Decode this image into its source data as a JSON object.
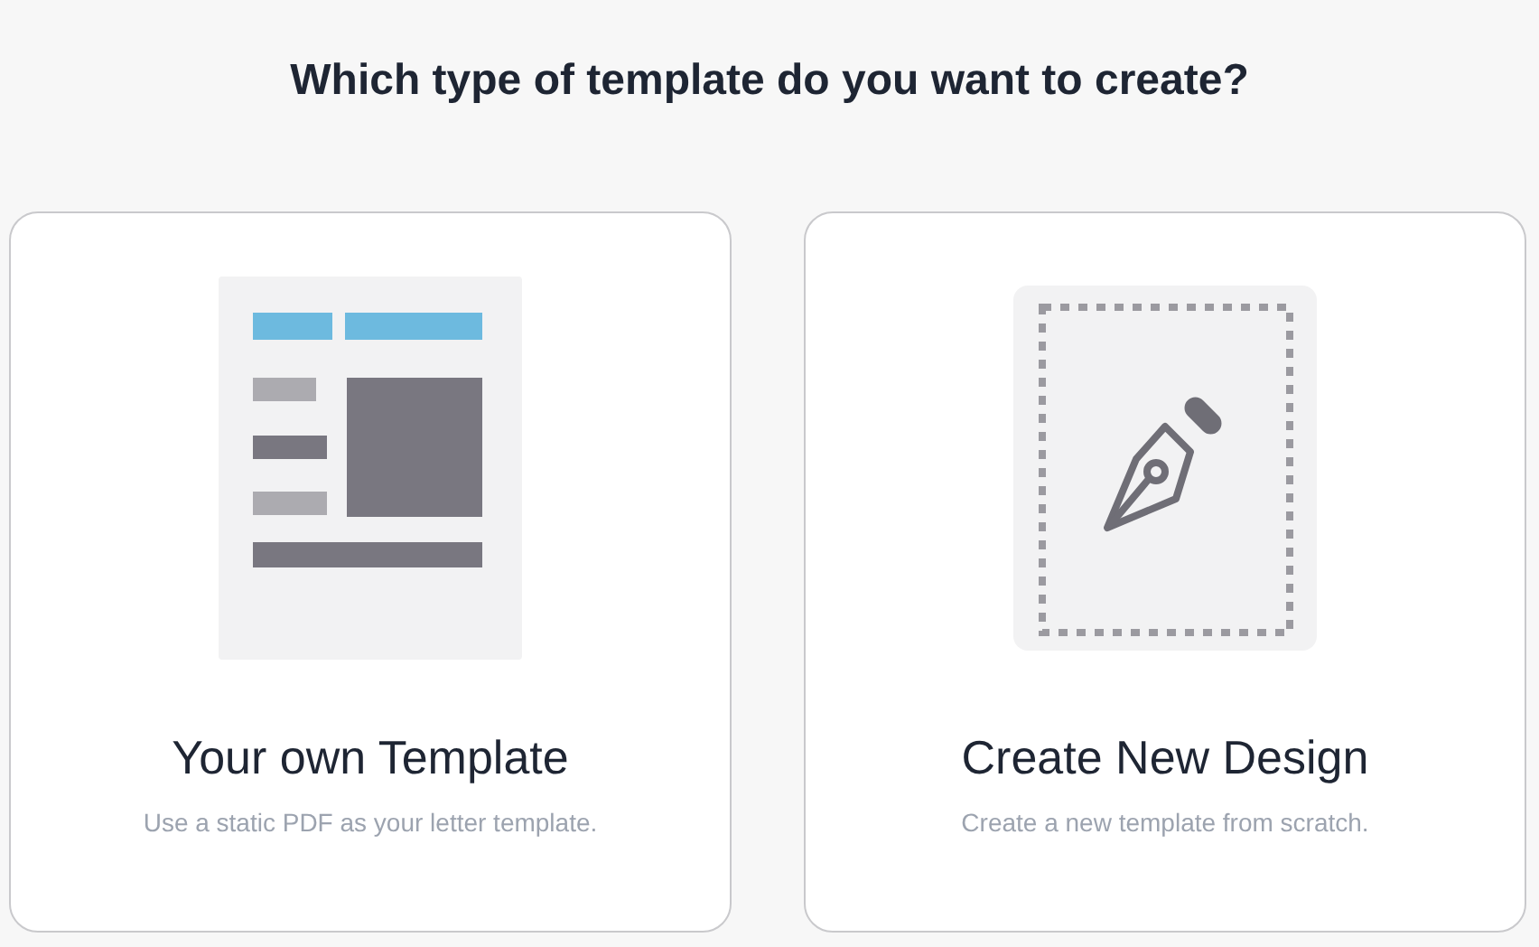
{
  "heading": "Which type of template do you want to create?",
  "options": [
    {
      "kind": "document",
      "title": "Your own Template",
      "description": "Use a static PDF as your letter template."
    },
    {
      "kind": "design",
      "title": "Create New Design",
      "description": "Create a new template from scratch."
    }
  ]
}
